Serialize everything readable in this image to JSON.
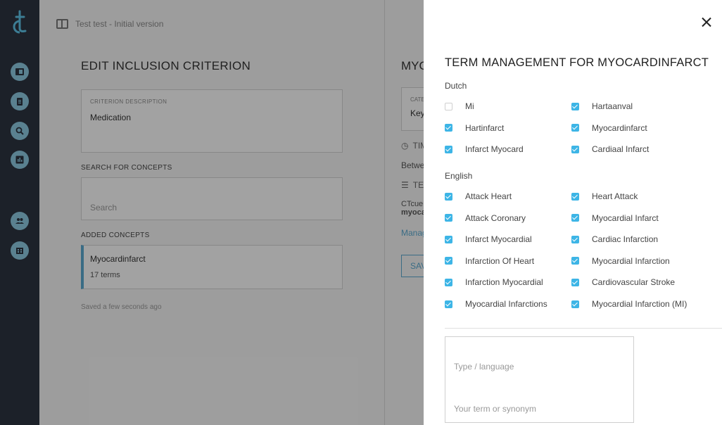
{
  "breadcrumb": {
    "text": "Test test - Initial version"
  },
  "edit": {
    "title": "EDIT INCLUSION CRITERION",
    "criterion_label": "CRITERION DESCRIPTION",
    "criterion_value": "Medication",
    "search_label": "SEARCH FOR CONCEPTS",
    "search_placeholder": "Search",
    "added_label": "ADDED CONCEPTS",
    "concept_name": "Myocardinfarct",
    "concept_terms": "17 terms",
    "saved": "Saved a few seconds ago"
  },
  "right_pane": {
    "title": "MYOCARDINFARCT",
    "box_label": "CATEGORY",
    "box_value": "Keyword",
    "timing": "TIMING",
    "between": "Between",
    "terms_head": "TERMS",
    "ctcue": "CTcue",
    "myoca": "myoca",
    "manage": "Manage",
    "save": "SAVE"
  },
  "drawer": {
    "title": "TERM MANAGEMENT FOR MYOCARDINFARCT",
    "dutch_label": "Dutch",
    "english_label": "English",
    "dutch_terms": [
      {
        "label": "Mi",
        "checked": false
      },
      {
        "label": "Hartaanval",
        "checked": true
      },
      {
        "label": "Hartinfarct",
        "checked": true
      },
      {
        "label": "Myocardinfarct",
        "checked": true
      },
      {
        "label": "Infarct Myocard",
        "checked": true
      },
      {
        "label": "Cardiaal Infarct",
        "checked": true
      }
    ],
    "english_terms": [
      {
        "label": "Attack Heart",
        "checked": true
      },
      {
        "label": "Heart Attack",
        "checked": true
      },
      {
        "label": "Attack Coronary",
        "checked": true
      },
      {
        "label": "Myocardial Infarct",
        "checked": true
      },
      {
        "label": "Infarct Myocardial",
        "checked": true
      },
      {
        "label": "Cardiac Infarction",
        "checked": true
      },
      {
        "label": "Infarction Of Heart",
        "checked": true
      },
      {
        "label": "Myocardial Infarction",
        "checked": true
      },
      {
        "label": "Infarction Myocardial",
        "checked": true
      },
      {
        "label": "Cardiovascular Stroke",
        "checked": true
      },
      {
        "label": "Myocardial Infarctions",
        "checked": true
      },
      {
        "label": "Myocardial Infarction (MI)",
        "checked": true
      }
    ],
    "type_placeholder": "Type / language",
    "term_placeholder": "Your term or synonym"
  },
  "colors": {
    "sidebar": "#2c3440",
    "accent": "#3db5e6",
    "link": "#5aa7cc"
  }
}
